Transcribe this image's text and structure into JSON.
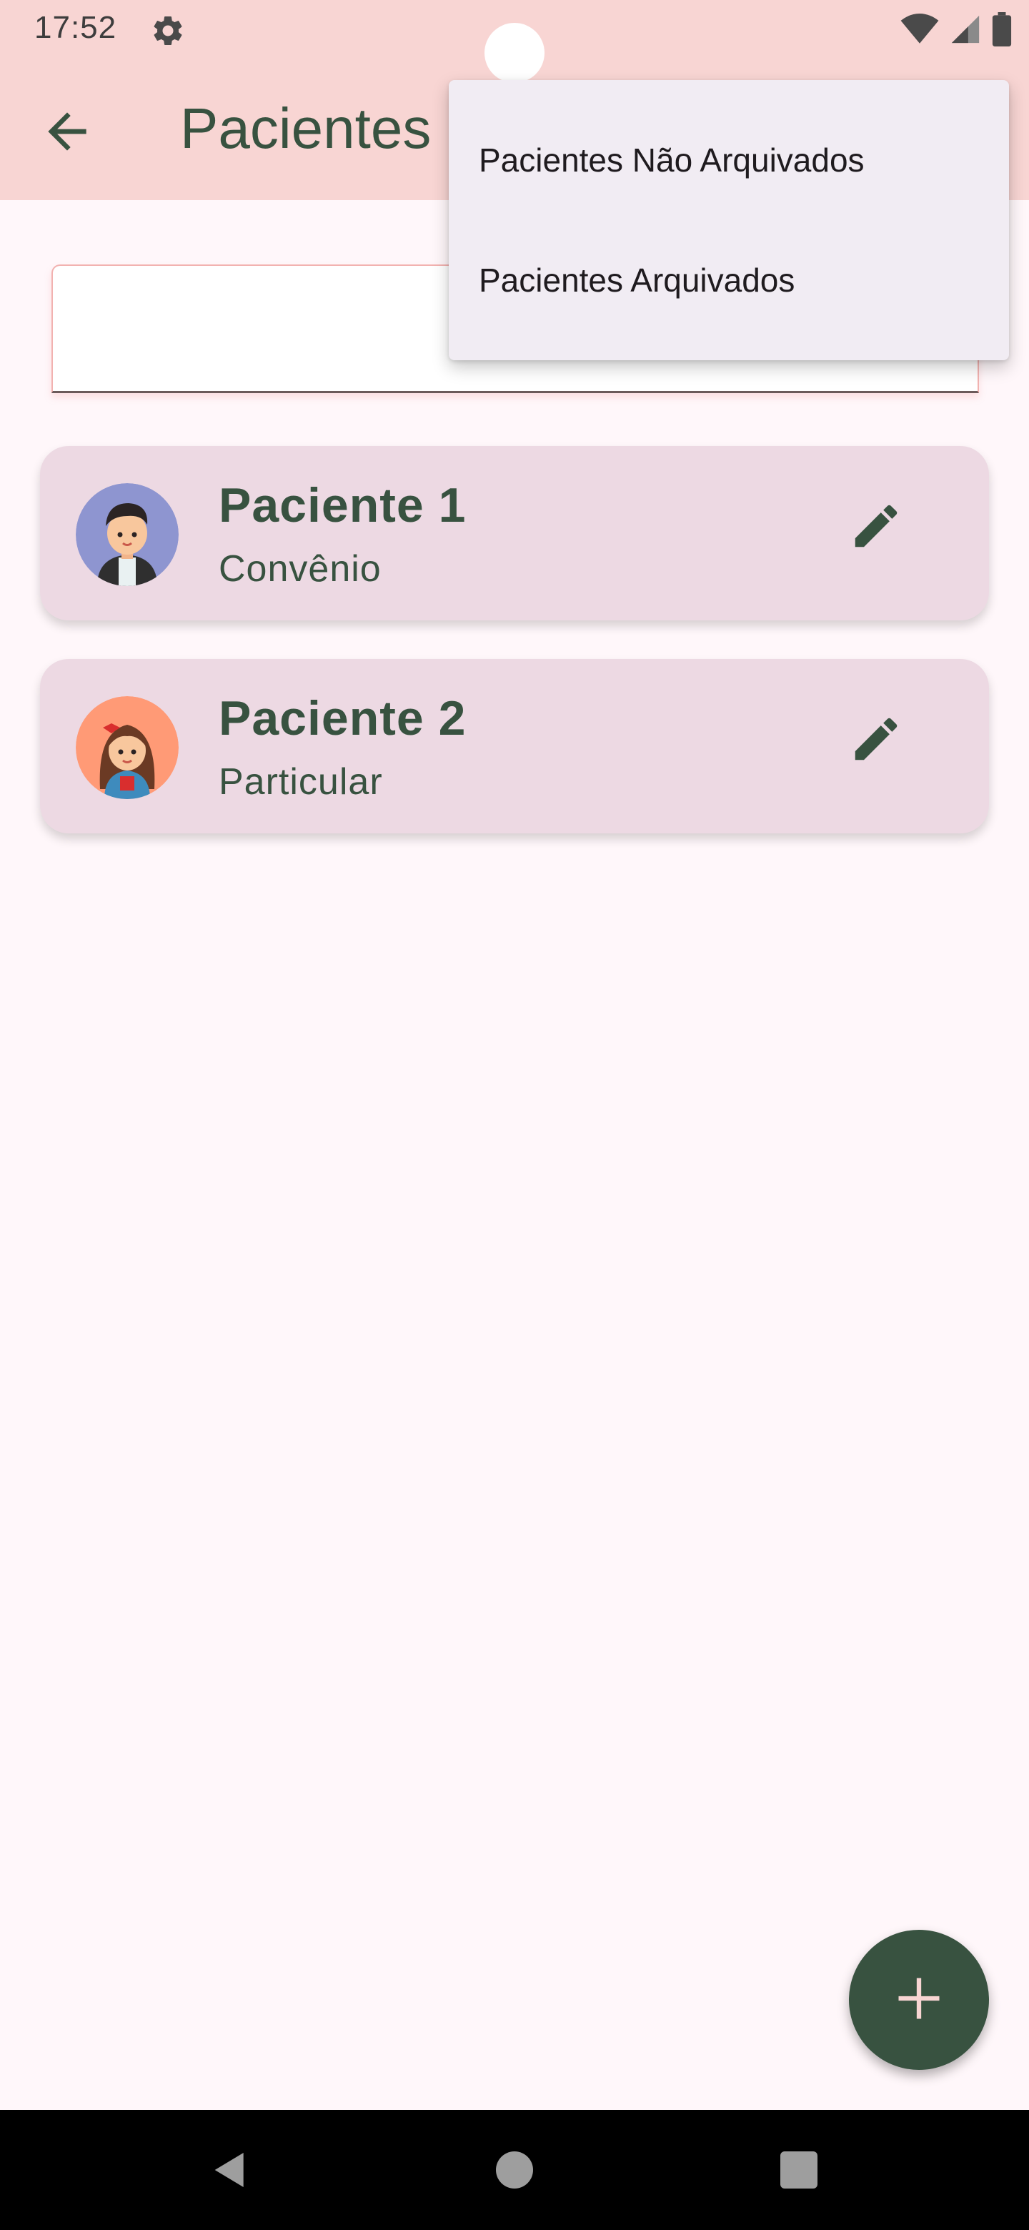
{
  "status_bar": {
    "time": "17:52",
    "settings_icon": "gear-icon",
    "wifi_icon": "wifi-icon",
    "signal_icon": "signal-icon",
    "battery_icon": "battery-icon"
  },
  "app_bar": {
    "back_icon": "arrow-back-icon",
    "title": "Pacientes"
  },
  "search": {
    "value": "",
    "placeholder": ""
  },
  "patients": [
    {
      "name": "Paciente 1",
      "type": "Convênio",
      "avatar": "boy-avatar",
      "avatar_bg": "#8E95D0",
      "edit_icon": "pencil-icon"
    },
    {
      "name": "Paciente 2",
      "type": "Particular",
      "avatar": "girl-avatar",
      "avatar_bg": "#FF9A76",
      "edit_icon": "pencil-icon"
    }
  ],
  "filter_menu": {
    "items": [
      "Pacientes Não Arquivados",
      "Pacientes Arquivados"
    ]
  },
  "fab": {
    "icon": "plus-icon"
  },
  "colors": {
    "app_bar": "#F8D5D3",
    "background": "#FFF7FA",
    "card": "#EDD9E3",
    "primary": "#385240",
    "menu": "#F1ECF3",
    "fab_icon": "#F8D5D3"
  },
  "nav_bar": {
    "back_icon": "nav-back-icon",
    "home_icon": "nav-home-icon",
    "recents_icon": "nav-recents-icon"
  }
}
